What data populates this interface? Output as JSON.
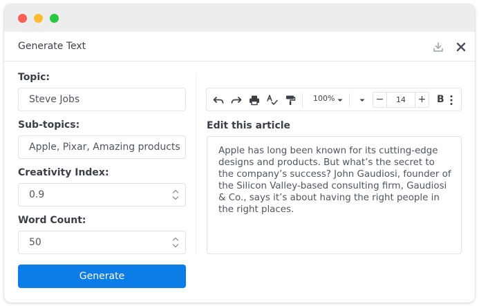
{
  "window": {
    "title": "Generate Text",
    "controls": [
      "close",
      "minimize",
      "maximize"
    ],
    "colors": {
      "close": "#fe5f57",
      "minimize": "#febc2e",
      "maximize": "#28c840"
    }
  },
  "header": {
    "download_icon": "download-icon",
    "close_icon": "close-icon"
  },
  "form": {
    "topic": {
      "label": "Topic:",
      "value": "Steve Jobs"
    },
    "subtopics": {
      "label": "Sub-topics:",
      "value": "Apple, Pixar, Amazing products"
    },
    "creativity": {
      "label": "Creativity Index:",
      "value": "0.9"
    },
    "word_count": {
      "label": "Word Count:",
      "value": "50"
    },
    "generate_label": "Generate"
  },
  "toolbar": {
    "icons": [
      "undo-icon",
      "redo-icon",
      "print-icon",
      "spellcheck-icon",
      "paint-format-icon",
      "chevron-down-icon",
      "more-vert-icon"
    ],
    "zoom": "100%",
    "font_size": "14",
    "decrease": "−",
    "increase": "+",
    "bold": "B"
  },
  "editor": {
    "label": "Edit this article",
    "content": "Apple has long been known for its cutting-edge designs and products. But what’s the secret to the company’s success? John Gaudiosi, founder of the Silicon Valley-based consulting firm, Gaudiosi & Co., says it’s about having the right people in the right places."
  },
  "colors": {
    "primary": "#0c7ce6",
    "text": "#3a3f47",
    "border": "#dfe2e6"
  }
}
